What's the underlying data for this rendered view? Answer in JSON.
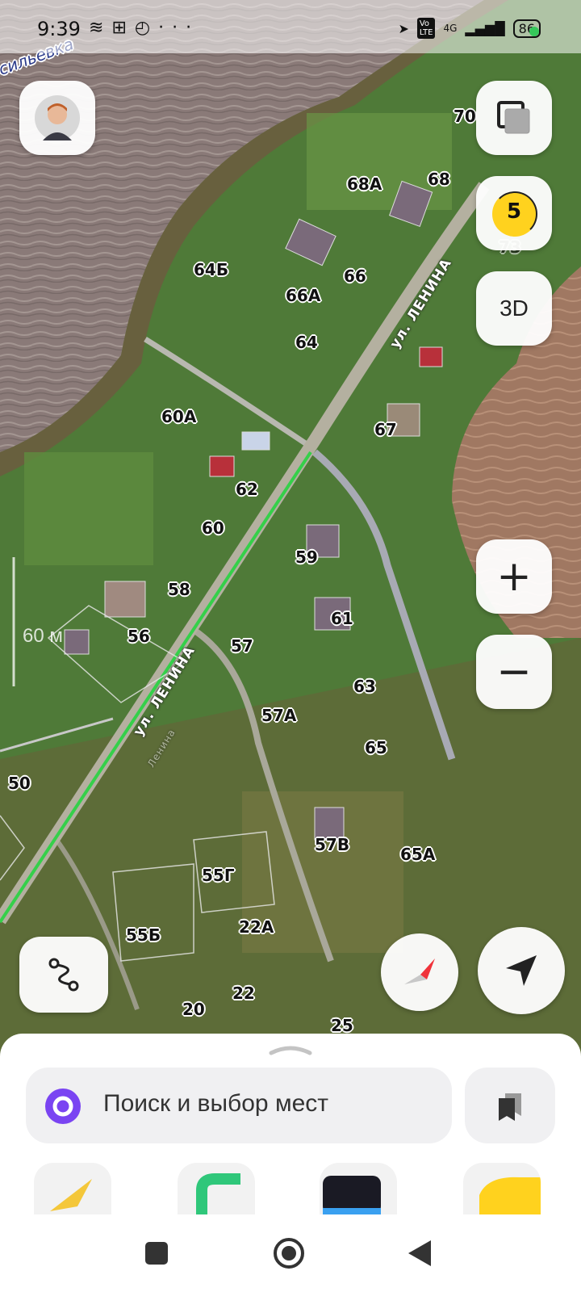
{
  "status_bar": {
    "time": "9:39",
    "left_icons": [
      "layers-icon",
      "gift-icon",
      "check-circle-icon",
      "more-icon"
    ],
    "network": "4G",
    "battery": "86",
    "battery_dot_color": "#35c85a"
  },
  "map": {
    "district_label": "сильевка",
    "street_name": "ул. ЛЕНИНА",
    "street_name_faint": "Ленина",
    "scale_label": "60 м",
    "house_numbers": [
      "70",
      "68А",
      "68",
      "64Б",
      "66",
      "66А",
      "64",
      "73",
      "60А",
      "67",
      "62",
      "60",
      "59",
      "58",
      "61",
      "56",
      "57",
      "63",
      "57А",
      "65",
      "50",
      "57В",
      "65А",
      "55Г",
      "22А",
      "55Б",
      "22",
      "20",
      "25"
    ]
  },
  "controls": {
    "layers_button": "layers-icon",
    "traffic_level": "5",
    "view_3d_label": "3D",
    "zoom_in": "+",
    "zoom_out": "−"
  },
  "bottom_sheet": {
    "search_placeholder": "Поиск и выбор мест",
    "apps": [
      "navigator-app",
      "market-app",
      "transport-app",
      "taxi-app"
    ]
  },
  "colors": {
    "route_green": "#35d04a",
    "alice_purple": "#7a44f2",
    "traffic_yellow": "#ffd21e",
    "compass_red": "#f0333a"
  }
}
